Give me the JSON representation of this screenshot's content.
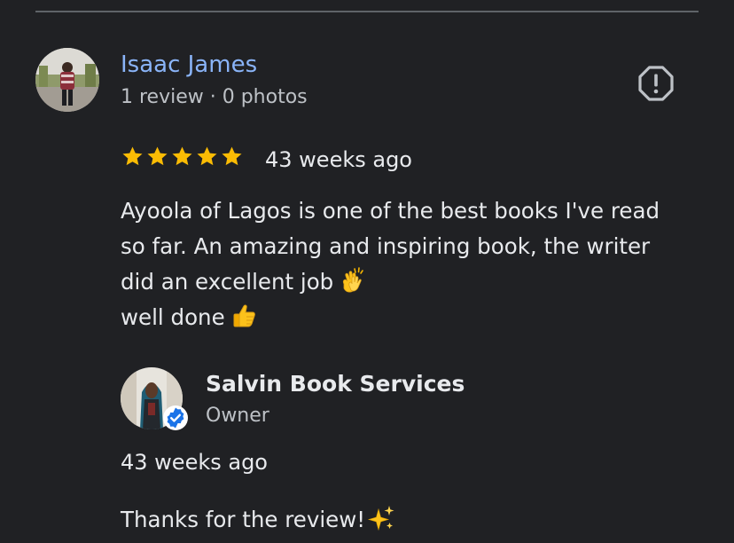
{
  "review": {
    "reviewer_name": "Isaac James",
    "reviewer_meta": "1 review · 0 photos",
    "rating": 5,
    "time_ago": "43 weeks ago",
    "text_lines": [
      "Ayoola of Lagos is one of the best books I've read",
      "so far. An amazing and inspiring book, the writer",
      "did an excellent job",
      "well done"
    ],
    "emojis": [
      "clapping-hands-emoji",
      "thumbs-up-emoji"
    ]
  },
  "reply": {
    "owner_name": "Salvin Book Services",
    "owner_role": "Owner",
    "time_ago": "43 weeks ago",
    "text": "Thanks for the review!",
    "emoji": "sparkles-emoji"
  },
  "icons": {
    "report": "report-alert-icon",
    "star": "star-icon",
    "verified": "verified-badge-icon"
  },
  "colors": {
    "background": "#202124",
    "reviewer_name": "#8ab4f8",
    "star": "#fbbc04",
    "secondary_text": "#bdc1c6",
    "verified_badge": "#1a73e8"
  }
}
